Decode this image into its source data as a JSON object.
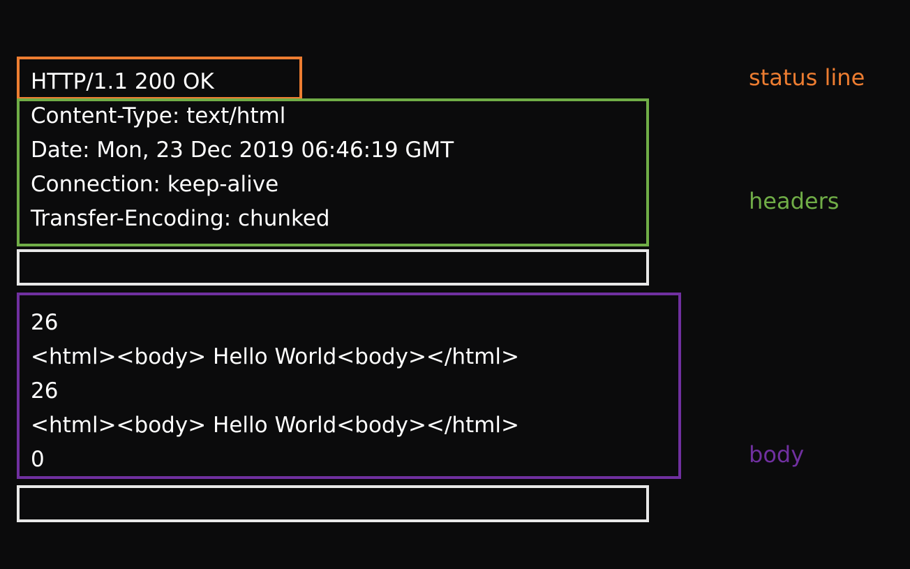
{
  "colors": {
    "background": "#0b0b0c",
    "status_line": "#ed7d31",
    "headers": "#70ad47",
    "blank": "#e8e8e8",
    "body": "#7030a0",
    "text": "#ffffff"
  },
  "status_line": {
    "text": "HTTP/1.1 200 OK",
    "label": "status line"
  },
  "headers": {
    "lines": [
      "Content-Type: text/html",
      "Date: Mon, 23 Dec 2019 06:46:19 GMT",
      "Connection: keep-alive",
      "Transfer-Encoding: chunked"
    ],
    "label": "headers"
  },
  "body": {
    "lines": [
      "26",
      "<html><body> Hello World<body></html>",
      "26",
      "<html><body> Hello World<body></html>",
      "0"
    ],
    "label": "body"
  }
}
